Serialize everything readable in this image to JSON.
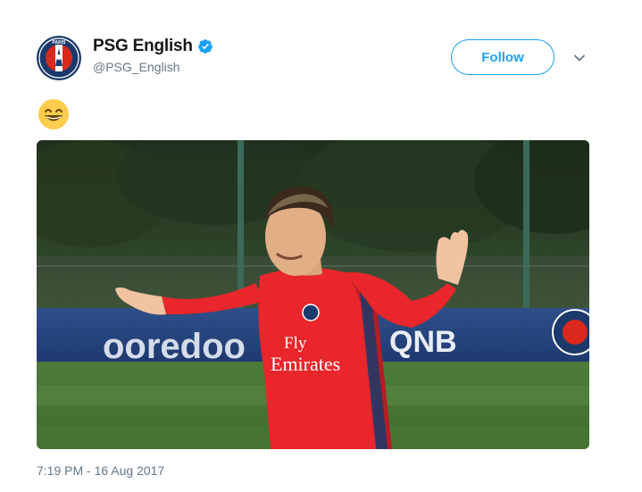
{
  "tweet": {
    "display_name": "PSG English",
    "handle": "@PSG_English",
    "verified": true,
    "follow_label": "Follow",
    "emoji": "grinning-face-with-smiling-eyes",
    "timestamp": "7:19 PM - 16 Aug 2017"
  },
  "avatar": {
    "badge_text": "PARIS"
  },
  "photo": {
    "shirt_sponsor_line1": "Fly",
    "shirt_sponsor_line2": "Emirates",
    "ad_board_left": "ooredoo",
    "ad_board_right": "QNB"
  },
  "colors": {
    "accent": "#1da1f2",
    "text": "#14171a",
    "secondary_text": "#657786",
    "psg_navy": "#1b3a6b",
    "psg_red": "#da291c",
    "shirt_red": "#e8262b"
  }
}
